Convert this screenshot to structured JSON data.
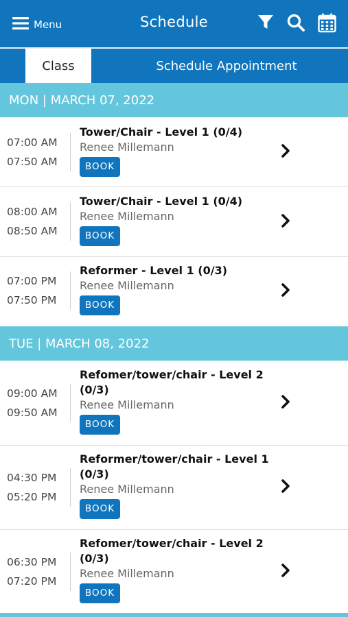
{
  "header": {
    "menu_label": "Menu",
    "title": "Schedule",
    "icons": [
      "menu-icon",
      "filter-icon",
      "search-icon",
      "calendar-icon"
    ]
  },
  "tabs": {
    "class_label": "Class",
    "appointment_label": "Schedule Appointment",
    "active": "Class"
  },
  "days": [
    {
      "label": "MON | MARCH 07, 2022",
      "classes": [
        {
          "start": "07:00 AM",
          "end": "07:50 AM",
          "name": "Tower/Chair - Level 1 (0/4)",
          "instructor": "Renee Millemann",
          "book_label": "BOOK"
        },
        {
          "start": "08:00 AM",
          "end": "08:50 AM",
          "name": "Tower/Chair - Level 1 (0/4)",
          "instructor": "Renee Millemann",
          "book_label": "BOOK"
        },
        {
          "start": "07:00 PM",
          "end": "07:50 PM",
          "name": "Reformer - Level 1 (0/3)",
          "instructor": "Renee Millemann",
          "book_label": "BOOK"
        }
      ]
    },
    {
      "label": "TUE | MARCH 08, 2022",
      "classes": [
        {
          "start": "09:00 AM",
          "end": "09:50 AM",
          "name_line1": "Refomer/tower/chair - Level 2",
          "name_line2": "(0/3)",
          "instructor": "Renee Millemann",
          "book_label": "BOOK"
        },
        {
          "start": "04:30 PM",
          "end": "05:20 PM",
          "name_line1": "Reformer/tower/chair - Level 1",
          "name_line2": "(0/3)",
          "instructor": "Renee Millemann",
          "book_label": "BOOK"
        },
        {
          "start": "06:30 PM",
          "end": "07:20 PM",
          "name_line1": "Refomer/tower/chair - Level 2",
          "name_line2": "(0/3)",
          "instructor": "Renee Millemann",
          "book_label": "BOOK"
        }
      ]
    }
  ],
  "colors": {
    "primary": "#1075bd",
    "day_header": "#64c6dc",
    "row_border": "#dcdcdc"
  }
}
